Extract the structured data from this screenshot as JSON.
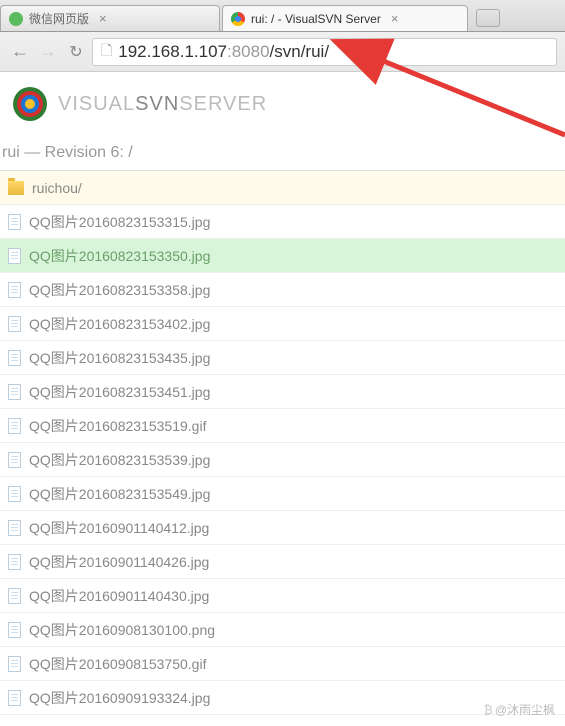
{
  "browser": {
    "tabs": [
      {
        "label": "微信网页版",
        "active": false,
        "icon": "green"
      },
      {
        "label": "rui: / - VisualSVN Server",
        "active": true,
        "icon": "chrome"
      }
    ],
    "url": {
      "host": "192.168.1.107",
      "port": ":8080",
      "path": "/svn/rui/"
    }
  },
  "page": {
    "logo": {
      "visual": "VISUAL",
      "svn": "SVN",
      "server": "SERVER"
    },
    "revision_text": "rui — Revision 6: /",
    "files": [
      {
        "name": "ruichou/",
        "type": "folder",
        "highlighted": false
      },
      {
        "name": "QQ图片20160823153315.jpg",
        "type": "file",
        "highlighted": false
      },
      {
        "name": "QQ图片20160823153350.jpg",
        "type": "file",
        "highlighted": true
      },
      {
        "name": "QQ图片20160823153358.jpg",
        "type": "file",
        "highlighted": false
      },
      {
        "name": "QQ图片20160823153402.jpg",
        "type": "file",
        "highlighted": false
      },
      {
        "name": "QQ图片20160823153435.jpg",
        "type": "file",
        "highlighted": false
      },
      {
        "name": "QQ图片20160823153451.jpg",
        "type": "file",
        "highlighted": false
      },
      {
        "name": "QQ图片20160823153519.gif",
        "type": "file",
        "highlighted": false
      },
      {
        "name": "QQ图片20160823153539.jpg",
        "type": "file",
        "highlighted": false
      },
      {
        "name": "QQ图片20160823153549.jpg",
        "type": "file",
        "highlighted": false
      },
      {
        "name": "QQ图片20160901140412.jpg",
        "type": "file",
        "highlighted": false
      },
      {
        "name": "QQ图片20160901140426.jpg",
        "type": "file",
        "highlighted": false
      },
      {
        "name": "QQ图片20160901140430.jpg",
        "type": "file",
        "highlighted": false
      },
      {
        "name": "QQ图片20160908130100.png",
        "type": "file",
        "highlighted": false
      },
      {
        "name": "QQ图片20160908153750.gif",
        "type": "file",
        "highlighted": false
      },
      {
        "name": "QQ图片20160909193324.jpg",
        "type": "file",
        "highlighted": false
      }
    ]
  },
  "watermark": "@沐雨尘枫"
}
